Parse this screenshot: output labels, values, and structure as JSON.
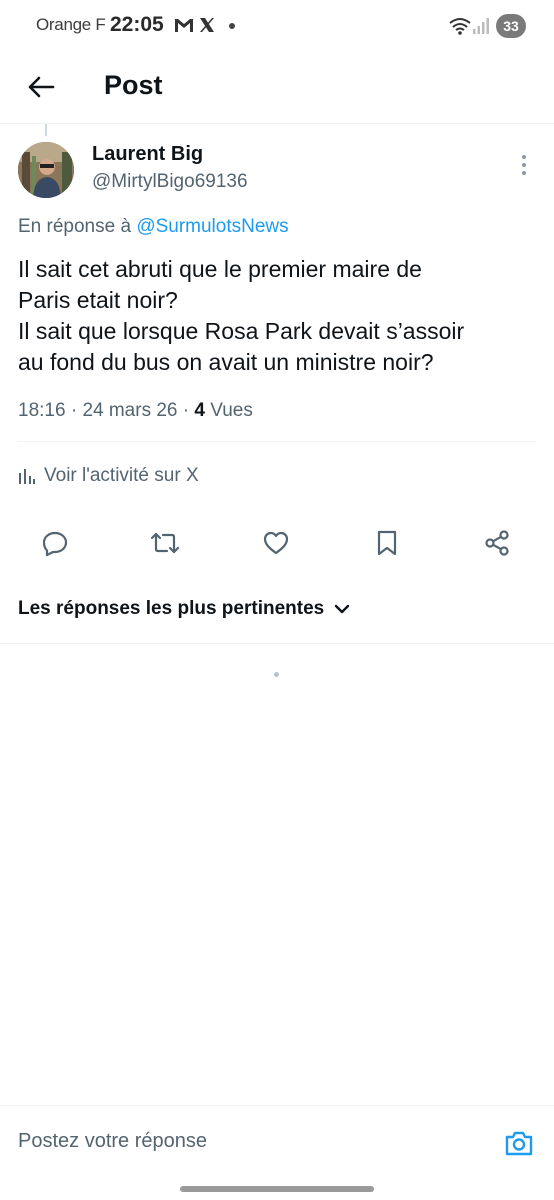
{
  "status_bar": {
    "carrier": "Orange F",
    "time": "22:05",
    "battery": "33",
    "icons": [
      "gmail-icon",
      "x-icon",
      "wifi-icon",
      "signal-icon"
    ]
  },
  "header": {
    "title": "Post",
    "back_icon": "arrow-left-icon"
  },
  "post": {
    "author_name": "Laurent Big",
    "author_handle": "@MirtylBigo69136",
    "reply_prefix": "En réponse à",
    "reply_to": "@SurmulotsNews",
    "text_lines": [
      "Il sait cet abruti que le premier maire de",
      "Paris etait noir?",
      "Il sait que lorsque Rosa Park devait s’assoir",
      "au fond du bus on avait un ministre noir?"
    ],
    "time": "18:16",
    "date": "24 mars 26",
    "views_count": "4",
    "views_label": "Vues",
    "activity_label": "Voir l'activité sur X"
  },
  "actions": [
    "reply-icon",
    "retweet-icon",
    "like-icon",
    "bookmark-icon",
    "share-icon"
  ],
  "replies": {
    "sort_label": "Les réponses les plus pertinentes"
  },
  "composer": {
    "placeholder": "Postez votre réponse"
  },
  "colors": {
    "accent": "#1d9bf0",
    "text_primary": "#0f1419",
    "text_secondary": "#536471",
    "divider": "#eff3f4"
  }
}
